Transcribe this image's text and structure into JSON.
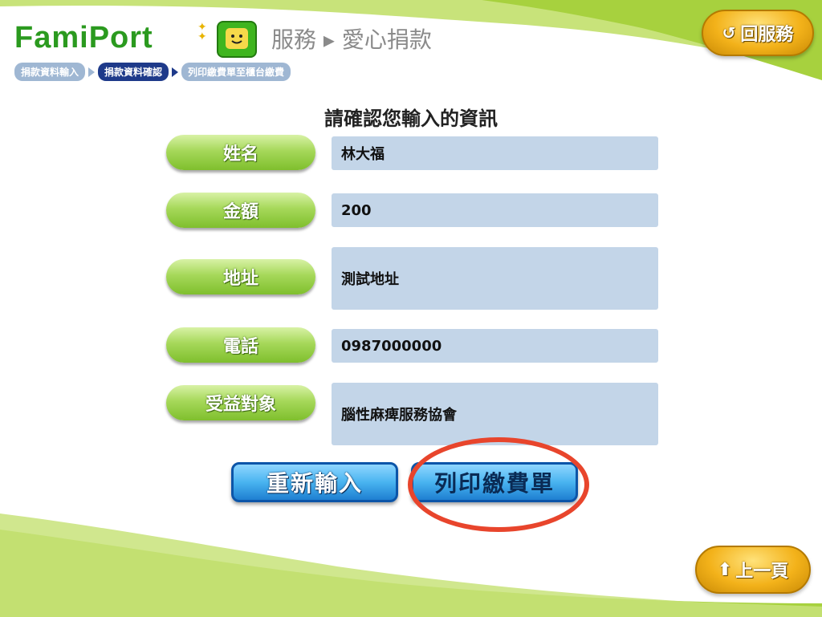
{
  "header": {
    "logo_text": "FamiPort",
    "breadcrumb_title": "服務 ▸ 愛心捐款",
    "back_service_label": "回服務",
    "steps": [
      {
        "label": "捐款資料輸入",
        "active": false
      },
      {
        "label": "捐款資料確認",
        "active": true
      },
      {
        "label": "列印繳費單至櫃台繳費",
        "active": false
      }
    ]
  },
  "main": {
    "heading": "請確認您輸入的資訊",
    "rows": [
      {
        "label": "姓名",
        "value": "林大福"
      },
      {
        "label": "金額",
        "value": "200"
      },
      {
        "label": "地址",
        "value": "測試地址"
      },
      {
        "label": "電話",
        "value": "0987000000"
      },
      {
        "label": "受益對象",
        "value": "腦性麻痺服務協會"
      }
    ],
    "reenter_label": "重新輸入",
    "print_label": "列印繳費單"
  },
  "footer": {
    "prev_page_label": "上一頁"
  },
  "colors": {
    "brand_green": "#2b9a1f",
    "label_green": "#a6d85a",
    "value_bg": "#c3d5e8",
    "action_blue": "#49b4f0",
    "highlight_red": "#e8452c",
    "gold": "#f3b21a"
  }
}
